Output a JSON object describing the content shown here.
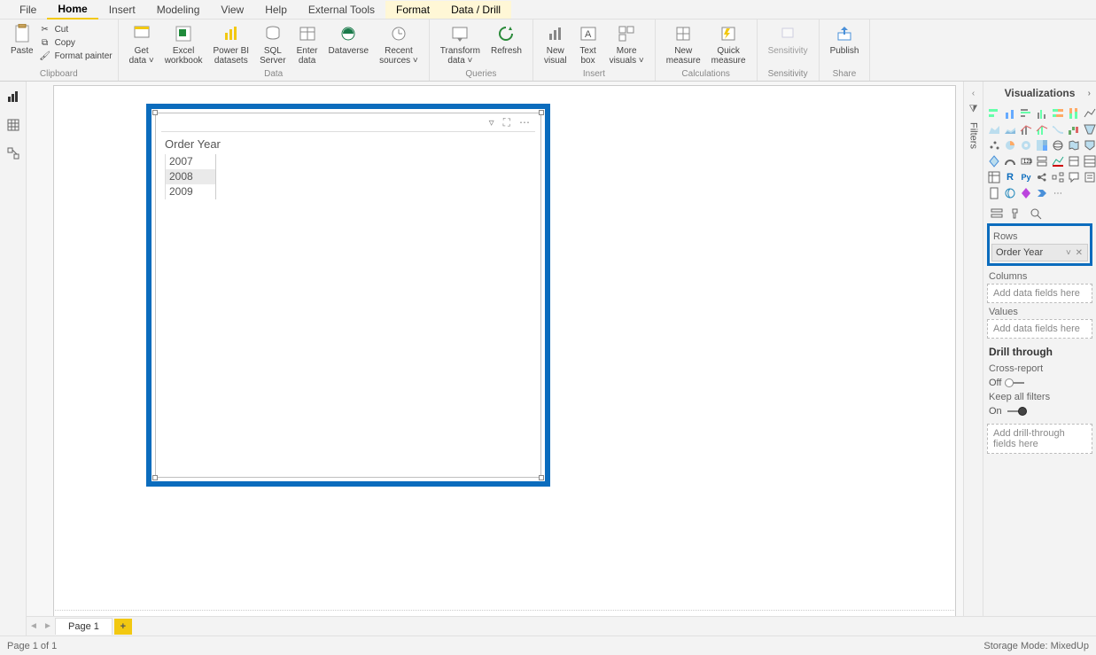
{
  "menu": {
    "items": [
      "File",
      "Home",
      "Insert",
      "Modeling",
      "View",
      "Help",
      "External Tools",
      "Format",
      "Data / Drill"
    ],
    "active_index": 1,
    "highlight_indexes": [
      7,
      8
    ]
  },
  "ribbon": {
    "clipboard": {
      "label": "Clipboard",
      "paste": "Paste",
      "cut": "Cut",
      "copy": "Copy",
      "format_painter": "Format painter"
    },
    "data": {
      "label": "Data",
      "buttons": [
        {
          "label": "Get\ndata ˅"
        },
        {
          "label": "Excel\nworkbook"
        },
        {
          "label": "Power BI\ndatasets"
        },
        {
          "label": "SQL\nServer"
        },
        {
          "label": "Enter\ndata"
        },
        {
          "label": "Dataverse"
        },
        {
          "label": "Recent\nsources ˅"
        }
      ]
    },
    "queries": {
      "label": "Queries",
      "buttons": [
        {
          "label": "Transform\ndata ˅"
        },
        {
          "label": "Refresh"
        }
      ]
    },
    "insert": {
      "label": "Insert",
      "buttons": [
        {
          "label": "New\nvisual"
        },
        {
          "label": "Text\nbox"
        },
        {
          "label": "More\nvisuals ˅"
        }
      ]
    },
    "calculations": {
      "label": "Calculations",
      "buttons": [
        {
          "label": "New\nmeasure"
        },
        {
          "label": "Quick\nmeasure"
        }
      ]
    },
    "sensitivity": {
      "label": "Sensitivity",
      "button": "Sensitivity"
    },
    "share": {
      "label": "Share",
      "button": "Publish"
    }
  },
  "visual": {
    "title": "Order Year",
    "rows": [
      "2007",
      "2008",
      "2009"
    ],
    "selected_row_index": 1
  },
  "filters_pane": {
    "label": "Filters"
  },
  "viz_pane": {
    "title": "Visualizations",
    "rows_label": "Rows",
    "rows_field": "Order Year",
    "columns_label": "Columns",
    "columns_placeholder": "Add data fields here",
    "values_label": "Values",
    "values_placeholder": "Add data fields here",
    "drill_header": "Drill through",
    "cross_report_label": "Cross-report",
    "cross_report_state": "Off",
    "keep_filters_label": "Keep all filters",
    "keep_filters_state": "On",
    "drill_placeholder": "Add drill-through fields here"
  },
  "page_tabs": {
    "tab": "Page 1"
  },
  "status": {
    "left": "Page 1 of 1",
    "right": "Storage Mode: MixedUp"
  }
}
